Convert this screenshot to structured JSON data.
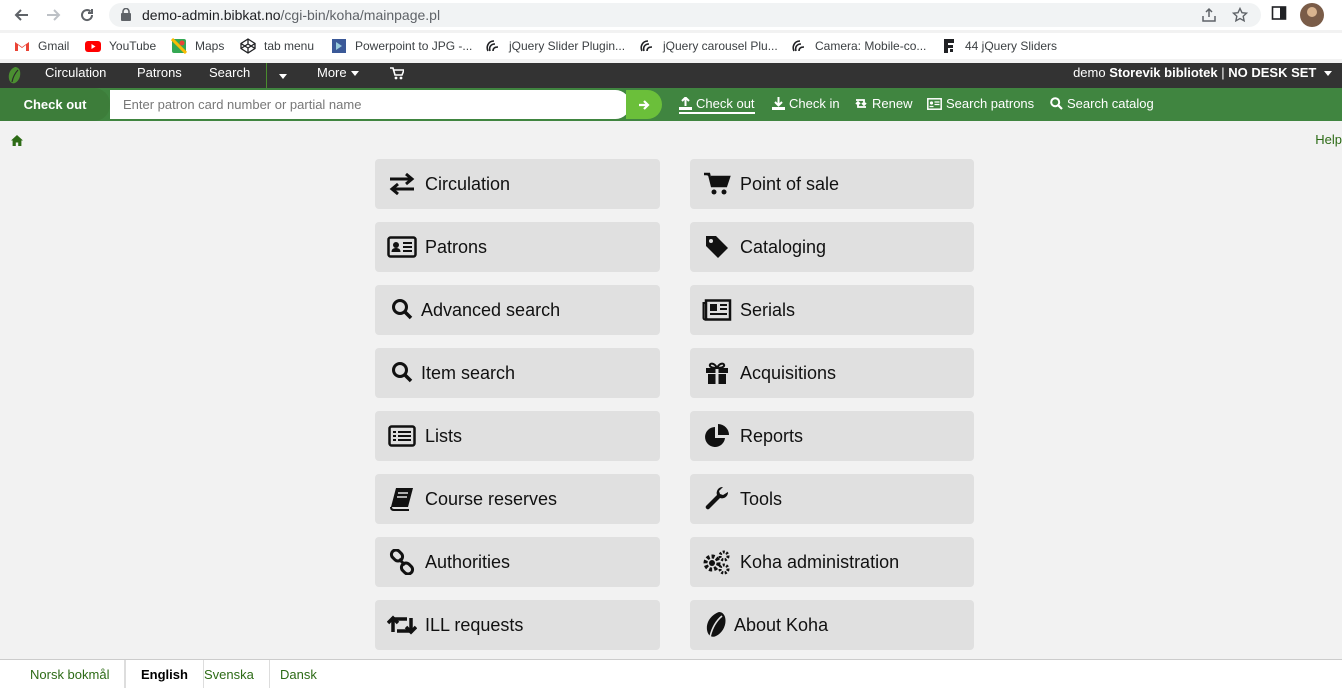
{
  "browser": {
    "url_host": "demo-admin.bibkat.no",
    "url_path": "/cgi-bin/koha/mainpage.pl",
    "bookmarks": [
      {
        "label": "Gmail",
        "icon": "gmail-icon"
      },
      {
        "label": "YouTube",
        "icon": "youtube-icon"
      },
      {
        "label": "Maps",
        "icon": "maps-icon"
      },
      {
        "label": "tab menu",
        "icon": "codepen-icon"
      },
      {
        "label": "Powerpoint to JPG -...",
        "icon": "play-icon"
      },
      {
        "label": "jQuery Slider Plugin...",
        "icon": "swirl-icon"
      },
      {
        "label": "jQuery carousel Plu...",
        "icon": "swirl-icon"
      },
      {
        "label": "Camera: Mobile-co...",
        "icon": "swirl-icon"
      },
      {
        "label": "44 jQuery Sliders",
        "icon": "f-icon"
      }
    ]
  },
  "topnav": {
    "items": [
      "Circulation",
      "Patrons",
      "Search",
      "More"
    ],
    "user": "demo",
    "library": "Storevik bibliotek",
    "desk": "NO DESK SET"
  },
  "checkout": {
    "label": "Check out",
    "placeholder": "Enter patron card number or partial name",
    "links": [
      "Check out",
      "Check in",
      "Renew",
      "Search patrons",
      "Search catalog"
    ]
  },
  "help": "Help",
  "tiles_left": [
    {
      "label": "Circulation",
      "icon": "arrows-exchange-icon"
    },
    {
      "label": "Patrons",
      "icon": "id-card-icon"
    },
    {
      "label": "Advanced search",
      "icon": "search-icon"
    },
    {
      "label": "Item search",
      "icon": "search-icon"
    },
    {
      "label": "Lists",
      "icon": "list-icon"
    },
    {
      "label": "Course reserves",
      "icon": "book-icon"
    },
    {
      "label": "Authorities",
      "icon": "link-icon"
    },
    {
      "label": "ILL requests",
      "icon": "retweet-icon"
    }
  ],
  "tiles_right": [
    {
      "label": "Point of sale",
      "icon": "cart-icon"
    },
    {
      "label": "Cataloging",
      "icon": "tag-icon"
    },
    {
      "label": "Serials",
      "icon": "newspaper-icon"
    },
    {
      "label": "Acquisitions",
      "icon": "gift-icon"
    },
    {
      "label": "Reports",
      "icon": "pie-chart-icon"
    },
    {
      "label": "Tools",
      "icon": "wrench-icon"
    },
    {
      "label": "Koha administration",
      "icon": "gears-icon"
    },
    {
      "label": "About Koha",
      "icon": "koha-leaf-icon"
    }
  ],
  "languages": [
    "Norsk bokmål",
    "English",
    "Svenska",
    "Dansk"
  ],
  "current_language": "English",
  "colors": {
    "topnav": "#333333",
    "checkout_bar": "#408540",
    "tile": "#e0e0e0",
    "link_green": "#2d6b16"
  }
}
